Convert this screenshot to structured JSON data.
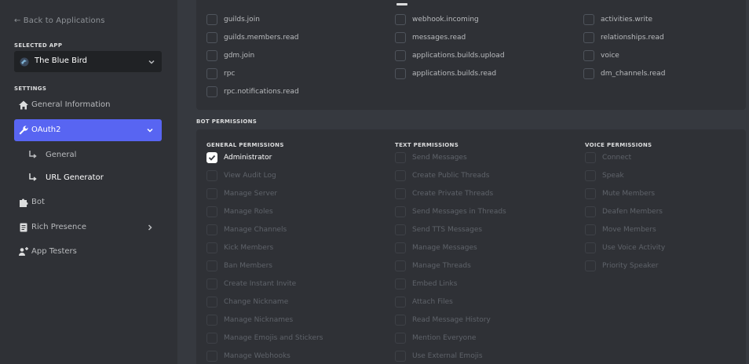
{
  "sidebar": {
    "back_link": "← Back to Applications",
    "selected_app_label": "SELECTED APP",
    "app_name": "The Blue Bird",
    "settings_label": "SETTINGS",
    "items": [
      {
        "label": "General Information",
        "icon": "home-icon"
      },
      {
        "label": "OAuth2",
        "icon": "wrench-icon",
        "active": true
      },
      {
        "label": "General",
        "icon": "sub-arrow-icon"
      },
      {
        "label": "URL Generator",
        "icon": "sub-arrow-icon",
        "selected": true
      },
      {
        "label": "Bot",
        "icon": "puzzle-icon"
      },
      {
        "label": "Rich Presence",
        "icon": "document-icon"
      },
      {
        "label": "App Testers",
        "icon": "users-icon"
      }
    ]
  },
  "scopes": {
    "col1": [
      "guilds.join",
      "guilds.members.read",
      "gdm.join",
      "rpc",
      "rpc.notifications.read"
    ],
    "col2": [
      "webhook.incoming",
      "messages.read",
      "applications.builds.upload",
      "applications.builds.read"
    ],
    "col3": [
      "activities.write",
      "relationships.read",
      "voice",
      "dm_channels.read"
    ]
  },
  "bot_permissions": {
    "title": "BOT PERMISSIONS",
    "general": {
      "heading": "GENERAL PERMISSIONS",
      "items": [
        "Administrator",
        "View Audit Log",
        "Manage Server",
        "Manage Roles",
        "Manage Channels",
        "Kick Members",
        "Ban Members",
        "Create Instant Invite",
        "Change Nickname",
        "Manage Nicknames",
        "Manage Emojis and Stickers",
        "Manage Webhooks"
      ]
    },
    "text": {
      "heading": "TEXT PERMISSIONS",
      "items": [
        "Send Messages",
        "Create Public Threads",
        "Create Private Threads",
        "Send Messages in Threads",
        "Send TTS Messages",
        "Manage Messages",
        "Manage Threads",
        "Embed Links",
        "Attach Files",
        "Read Message History",
        "Mention Everyone",
        "Use External Emojis"
      ]
    },
    "voice": {
      "heading": "VOICE PERMISSIONS",
      "items": [
        "Connect",
        "Speak",
        "Mute Members",
        "Deafen Members",
        "Move Members",
        "Use Voice Activity",
        "Priority Speaker"
      ]
    }
  },
  "colors": {
    "accent": "#5865f2",
    "sidebar_bg": "#2f3136",
    "main_bg": "#36393f"
  }
}
